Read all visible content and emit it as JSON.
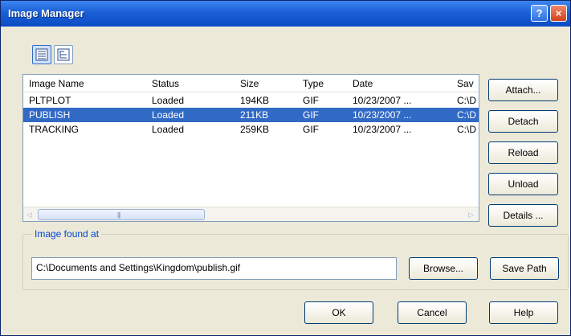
{
  "window": {
    "title": "Image Manager",
    "help_glyph": "?",
    "close_glyph": "×"
  },
  "list": {
    "columns": [
      "Image Name",
      "Status",
      "Size",
      "Type",
      "Date",
      "Sav"
    ],
    "rows": [
      {
        "name": "PLTPLOT",
        "status": "Loaded",
        "size": "194KB",
        "type": "GIF",
        "date": "10/23/2007 ...",
        "saved": "C:\\D"
      },
      {
        "name": "PUBLISH",
        "status": "Loaded",
        "size": "211KB",
        "type": "GIF",
        "date": "10/23/2007 ...",
        "saved": "C:\\D"
      },
      {
        "name": "TRACKING",
        "status": "Loaded",
        "size": "259KB",
        "type": "GIF",
        "date": "10/23/2007 ...",
        "saved": "C:\\D"
      }
    ],
    "selected_row": 1,
    "scroll_left_glyph": "◁",
    "scroll_right_glyph": "▷",
    "scroll_grip": "|||"
  },
  "buttons": {
    "attach": "Attach...",
    "detach": "Detach",
    "reload": "Reload",
    "unload": "Unload",
    "details": "Details ..."
  },
  "found": {
    "label": "Image found at",
    "path": "C:\\Documents and Settings\\Kingdom\\publish.gif",
    "browse": "Browse...",
    "save_path": "Save Path"
  },
  "footer": {
    "ok": "OK",
    "cancel": "Cancel",
    "help": "Help"
  },
  "colors": {
    "title_bar": "#0b4cc4",
    "selection": "#316ac5",
    "dialog_bg": "#ece9d8",
    "group_label": "#0046d5"
  },
  "icons": {
    "list_view": "list-view-icon",
    "tree_view": "tree-view-icon"
  }
}
